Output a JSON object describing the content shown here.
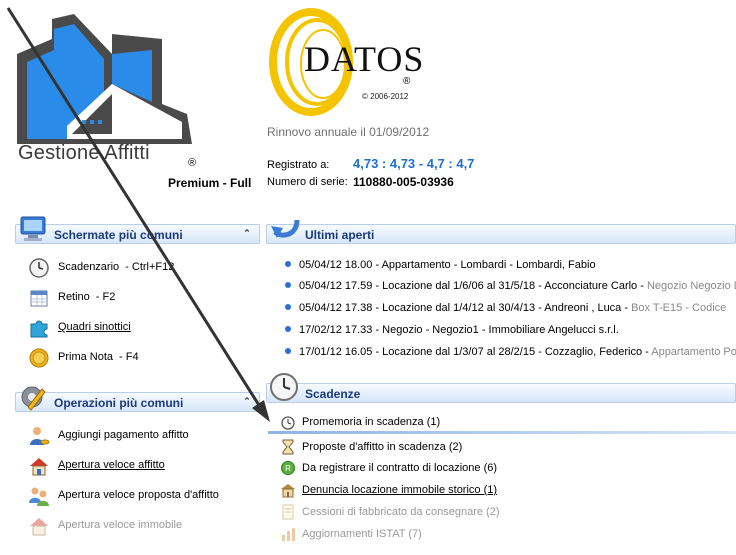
{
  "branding": {
    "app_name": "Gestione Affitti",
    "registered_mark": "®",
    "edition": "Premium - Full",
    "company": "DATOS",
    "company_mark": "®",
    "copyright": "© 2006-2012"
  },
  "license": {
    "renewal": "Rinnovo annuale il 01/09/2012",
    "registered_label": "Registrato a:",
    "registered_value": "4,73 : 4,73 - 4,7 : 4,7",
    "serial_label": "Numero di serie:",
    "serial_value": "110880-005-03936"
  },
  "common_screens": {
    "title": "Schermate più comuni",
    "items": [
      {
        "label": "Scadenzario",
        "shortcut": "- Ctrl+F12",
        "icon": "clock-icon"
      },
      {
        "label": "Retino",
        "shortcut": "- F2",
        "icon": "calendar-icon"
      },
      {
        "label": "Quadri sinottici",
        "shortcut": "",
        "icon": "puzzle-icon"
      },
      {
        "label": "Prima Nota",
        "shortcut": "- F4",
        "icon": "coin-icon"
      }
    ]
  },
  "common_operations": {
    "title": "Operazioni più comuni",
    "items": [
      {
        "label": "Aggiungi pagamento affitto",
        "icon": "person-coins-icon"
      },
      {
        "label": "Apertura veloce affitto",
        "icon": "house-icon"
      },
      {
        "label": "Apertura veloce proposta d'affitto",
        "icon": "people-icon"
      },
      {
        "label": "Apertura veloce immobile",
        "icon": "house-disabled-icon"
      }
    ]
  },
  "recent": {
    "title": "Ultimi aperti",
    "items": [
      {
        "text": "05/04/12 18.00 - Appartamento - Lombardi - Lombardi, Fabio",
        "extra": ""
      },
      {
        "text": "05/04/12 17.59 - Locazione dal 1/6/06 al 31/5/18 - Acconciature Carlo - ",
        "extra": "Negozio Negozio L"
      },
      {
        "text": "05/04/12 17.38 - Locazione dal 1/4/12 al 30/4/13 - Andreoni , Luca - ",
        "extra": "Box T-E15 - Codice"
      },
      {
        "text": "17/02/12 17.33 - Negozio - Negozio1 - Immobiliare Angelucci s.r.l.",
        "extra": ""
      },
      {
        "text": "17/01/12 16.05 - Locazione dal 1/3/07 al 28/2/15 - Cozzaglio, Federico - ",
        "extra": "Appartamento Po"
      }
    ]
  },
  "deadlines": {
    "title": "Scadenze",
    "items": [
      {
        "label": "Promemoria in scadenza (1)",
        "icon": "alarm-clock-icon"
      },
      {
        "label": "Proposte d'affitto in scadenza (2)",
        "icon": "hourglass-icon"
      },
      {
        "label": "Da registrare il contratto di locazione (6)",
        "icon": "green-circle-icon"
      },
      {
        "label": "Denuncia locazione immobile storico (1)",
        "icon": "building-icon"
      },
      {
        "label": "Cessioni di fabbricato da consegnare (2)",
        "icon": "document-icon"
      },
      {
        "label": "Aggiornamenti ISTAT (7)",
        "icon": "chart-icon"
      }
    ]
  }
}
